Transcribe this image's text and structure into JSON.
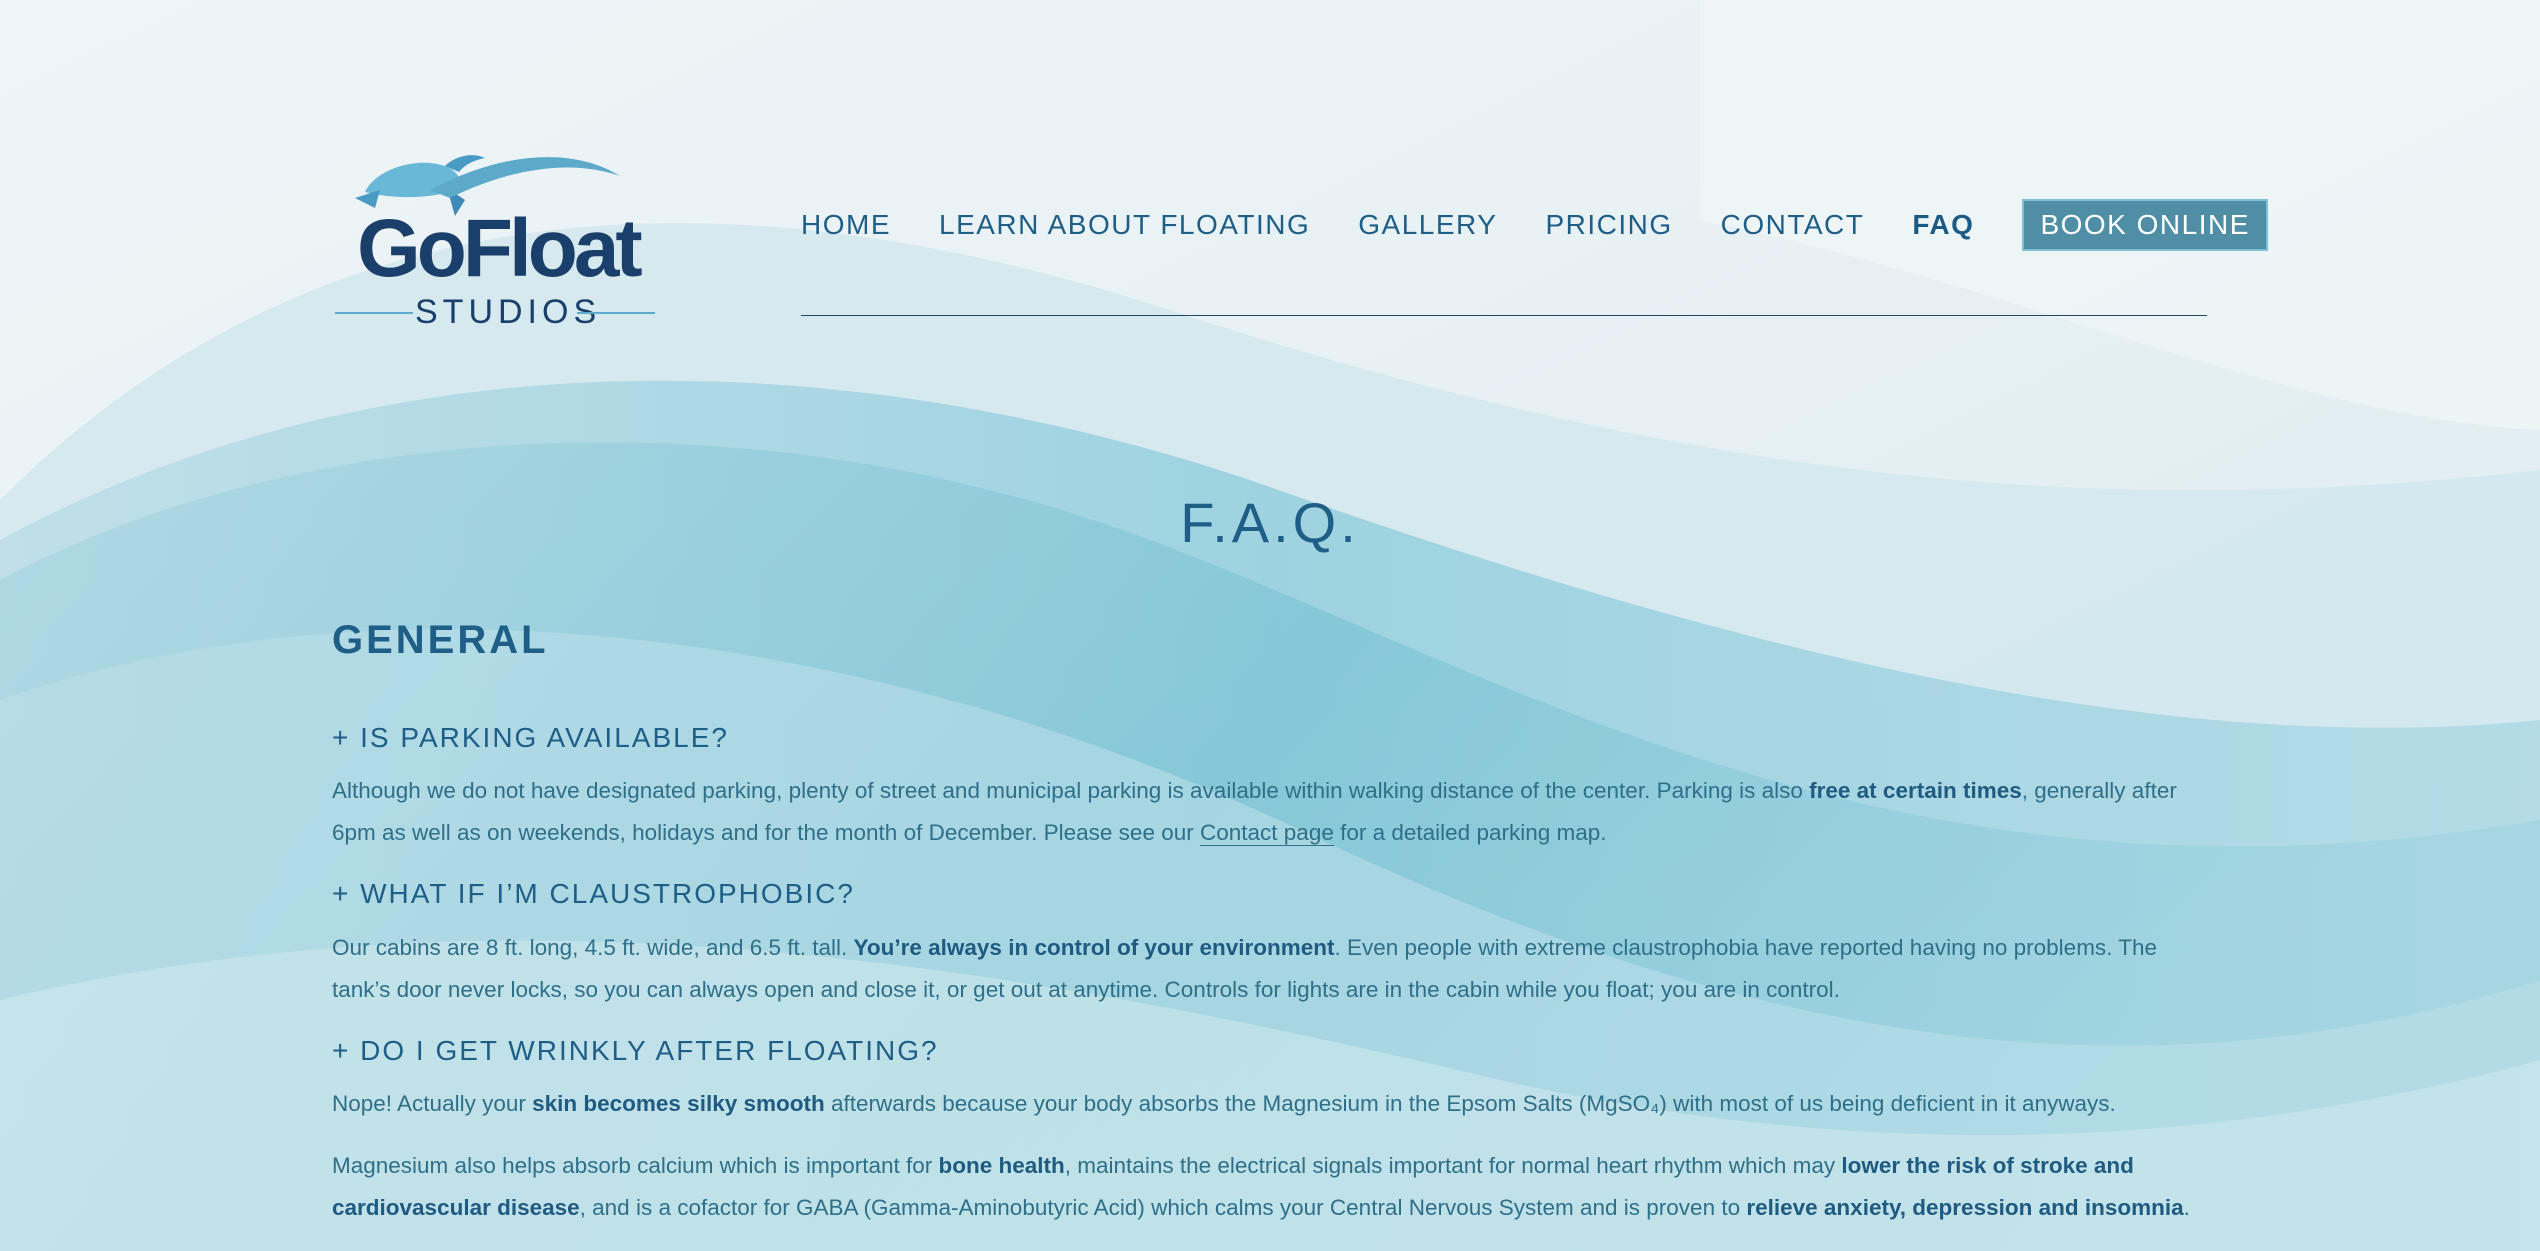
{
  "brand": {
    "name": "GoFloat",
    "sub": "STUDIOS",
    "colors": {
      "primary": "#1f5e86",
      "accent": "#4f8ea5",
      "logo_dark": "#1b3f6b",
      "logo_light": "#5da9c9"
    }
  },
  "nav": {
    "items": [
      {
        "label": "HOME"
      },
      {
        "label": "LEARN ABOUT FLOATING"
      },
      {
        "label": "GALLERY"
      },
      {
        "label": "PRICING"
      },
      {
        "label": "CONTACT"
      },
      {
        "label": "FAQ",
        "active": true
      }
    ],
    "book_label": "BOOK ONLINE"
  },
  "page": {
    "title": "F.A.Q.",
    "section": "GENERAL"
  },
  "faq": [
    {
      "question": "+ IS PARKING AVAILABLE?",
      "a1": "Although we do not have designated parking, plenty of street and municipal parking is available within walking distance of the center. Parking is also ",
      "a1_bold": "free at certain times",
      "a2": ", generally after 6pm as well as on weekends, holidays and for the month of December. Please see our ",
      "link": "Contact page",
      "a3": " for a detailed parking map."
    },
    {
      "question": "+ WHAT IF I’M CLAUSTROPHOBIC?",
      "a1": "Our cabins are 8 ft. long, 4.5 ft. wide, and 6.5 ft. tall. ",
      "a1_bold": "You’re always in control of your environment",
      "a2": ". Even people with extreme claustrophobia have reported having no problems. The tank’s door never locks, so you can always open and close it, or get out at anytime. Controls for lights are in the cabin while you float; you are in control."
    },
    {
      "question": "+ DO I GET WRINKLY AFTER FLOATING?",
      "p1_a": "Nope! Actually your ",
      "p1_bold": "skin becomes silky smooth",
      "p1_b": " afterwards because your body absorbs the Magnesium in the Epsom Salts (MgSO₄) with most of us being deficient in it anyways.",
      "p2_a": "Magnesium also helps absorb calcium which is important for ",
      "p2_bold1": "bone health",
      "p2_b": ", maintains the electrical signals important for normal heart rhythm which may ",
      "p2_bold2": "lower the risk of stroke and cardiovascular disease",
      "p2_c": ", and is a cofactor for GABA (Gamma-Aminobutyric Acid) which calms your Central Nervous System and is proven to ",
      "p2_bold3": "relieve anxiety, depression and insomnia",
      "p2_d": "."
    }
  ]
}
